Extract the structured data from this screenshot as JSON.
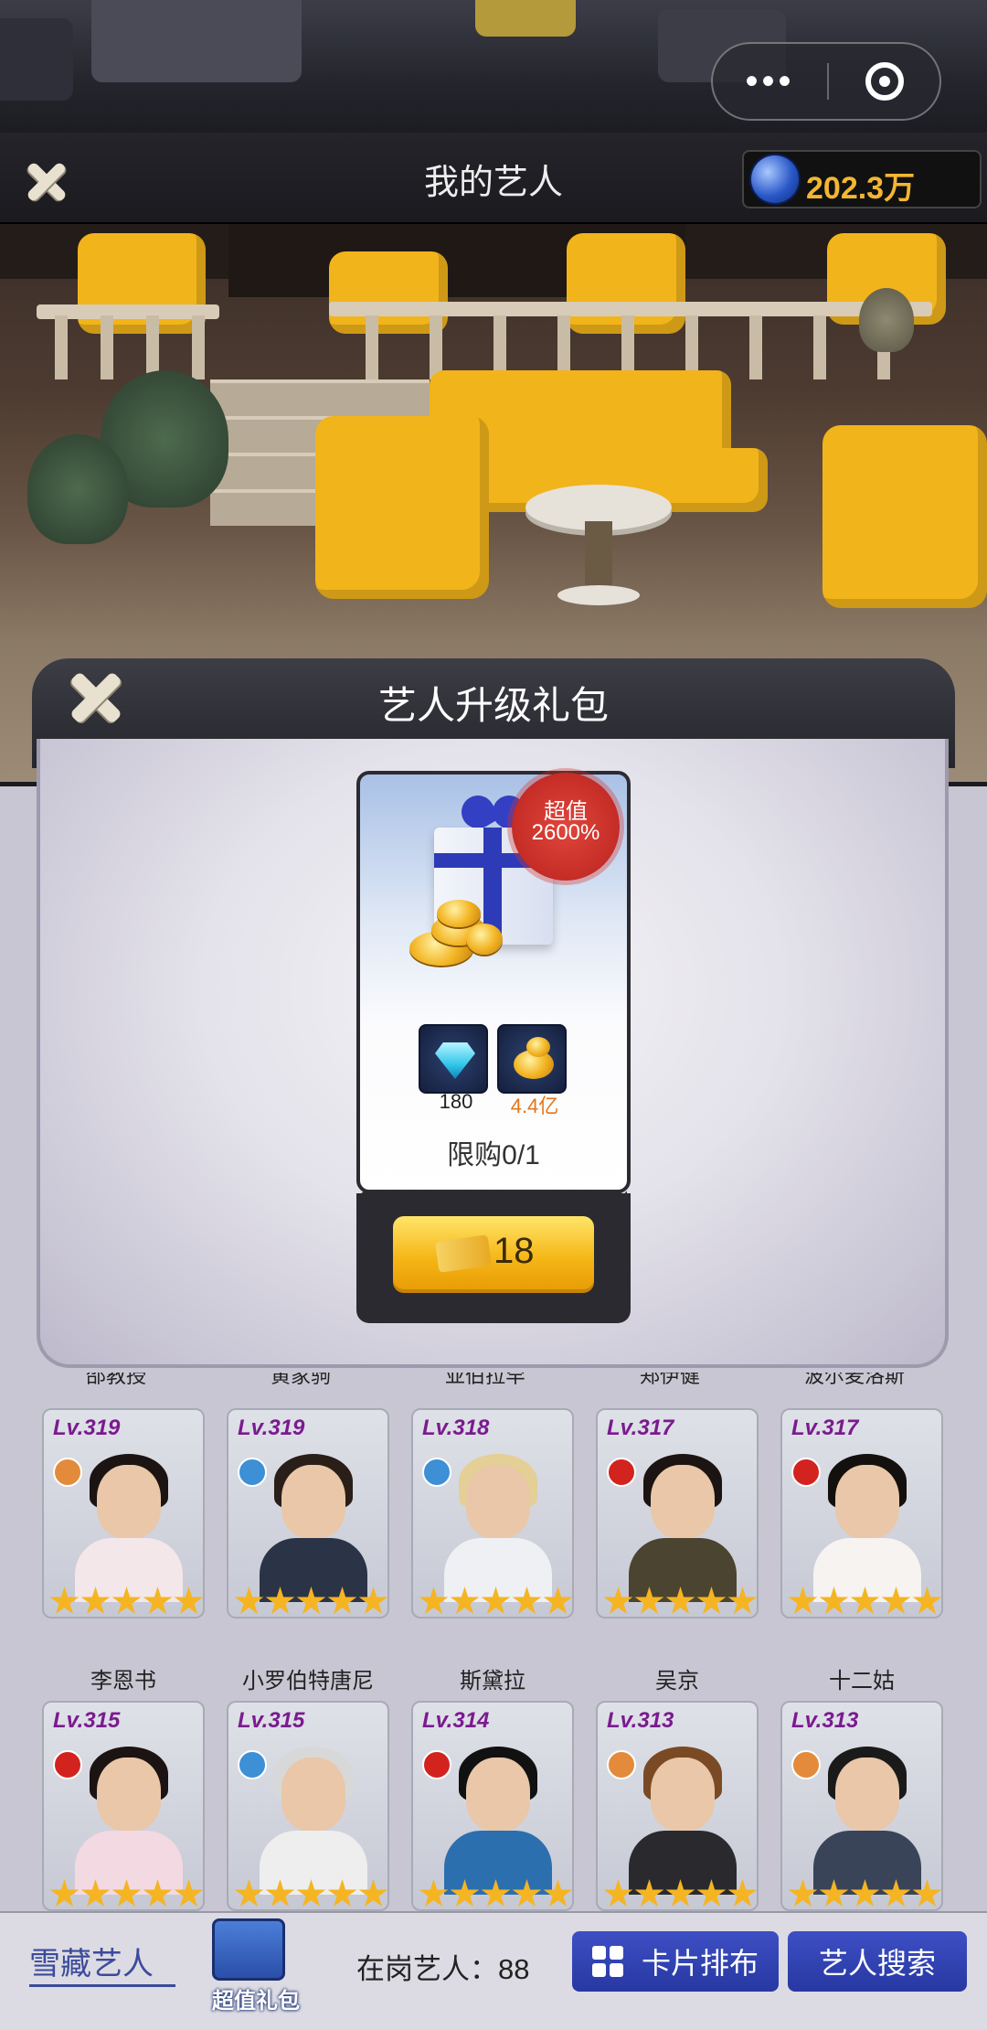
{
  "header": {
    "title": "我的艺人",
    "currency_icon": "globe-coin-icon",
    "currency_value": "202.3万"
  },
  "capsule": {
    "more": "•••"
  },
  "modal": {
    "title": "艺人升级礼包",
    "badge_line1": "超值",
    "badge_line2": "2600%",
    "rewards": [
      {
        "icon": "diamond-icon",
        "value": "180",
        "color": "#222222"
      },
      {
        "icon": "gold-coins-icon",
        "value": "4.4亿",
        "color": "#e3761b"
      }
    ],
    "limit": "限购0/1",
    "price": "18"
  },
  "partial_names": [
    "邵教授",
    "黄家驹",
    "亚伯拉罕",
    "郑伊健",
    "波尔麦洛斯"
  ],
  "artists": [
    {
      "level": "Lv.319",
      "name": "李恩书",
      "badge_color": "#e38b3a",
      "hair": "#1c1412",
      "body": "#f3e7ea"
    },
    {
      "level": "Lv.319",
      "name": "小罗伯特唐尼",
      "badge_color": "#3d8fd6",
      "hair": "#2a1e18",
      "body": "#2a3446"
    },
    {
      "level": "Lv.318",
      "name": "斯黛拉",
      "badge_color": "#3d8fd6",
      "hair": "#e4cf96",
      "body": "#eef0f4"
    },
    {
      "level": "Lv.317",
      "name": "吴京",
      "badge_color": "#d3231f",
      "hair": "#1b1412",
      "body": "#4a4430"
    },
    {
      "level": "Lv.317",
      "name": "十二姑",
      "badge_color": "#d3231f",
      "hair": "#14100e",
      "body": "#f6f3f0"
    },
    {
      "level": "Lv.315",
      "name": "",
      "badge_color": "#d3231f",
      "hair": "#1c1412",
      "body": "#f3d9e2"
    },
    {
      "level": "Lv.315",
      "name": "",
      "badge_color": "#3d8fd6",
      "hair": "#d8d8d8",
      "body": "#eeeeee"
    },
    {
      "level": "Lv.314",
      "name": "",
      "badge_color": "#d3231f",
      "hair": "#111111",
      "body": "#2b6fae"
    },
    {
      "level": "Lv.313",
      "name": "",
      "badge_color": "#e38b3a",
      "hair": "#7a4a24",
      "body": "#2a2a2e"
    },
    {
      "level": "Lv.313",
      "name": "",
      "badge_color": "#e38b3a",
      "hair": "#1a1a1a",
      "body": "#3a4458"
    }
  ],
  "bottom": {
    "tab_snow": "雪藏艺人",
    "gift_box_label": "超值礼包",
    "on_duty": "在岗艺人：88",
    "card_layout_button": "卡片排布",
    "search_button": "艺人搜索"
  }
}
